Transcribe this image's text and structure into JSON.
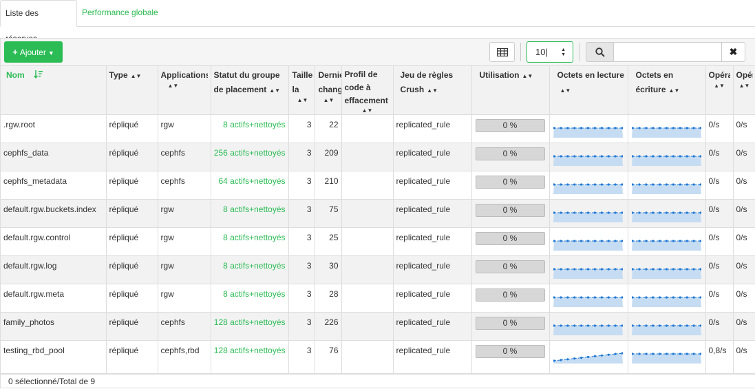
{
  "tabs": [
    {
      "label": "Liste des réserves"
    },
    {
      "label": "Performance globale"
    }
  ],
  "toolbar": {
    "add_label": "Ajouter",
    "page_size": "10",
    "search_placeholder": ""
  },
  "columns": [
    {
      "label": "Nom"
    },
    {
      "label": "Type"
    },
    {
      "label": "Applications"
    },
    {
      "label": "Statut du groupe de placement"
    },
    {
      "label": "Taille de la"
    },
    {
      "label": "Dernier changement"
    },
    {
      "label": "Profil de code à effacement"
    },
    {
      "label": "Jeu de règles Crush"
    },
    {
      "label": "Utilisation"
    },
    {
      "label": "Octets en lecture"
    },
    {
      "label": "Octets en écriture"
    },
    {
      "label": "Opérations de lecture"
    },
    {
      "label": "Opérations d'écriture"
    }
  ],
  "rows": [
    {
      "name": ".rgw.root",
      "type": "répliqué",
      "apps": "rgw",
      "pg_status": "8 actifs+nettoyés",
      "size": "3",
      "last_change": "22",
      "ec_profile": "",
      "crush": "replicated_rule",
      "usage": "0 %",
      "read_ops": "0/s",
      "write_ops": "0/s"
    },
    {
      "name": "cephfs_data",
      "type": "répliqué",
      "apps": "cephfs",
      "pg_status": "256 actifs+nettoyés",
      "size": "3",
      "last_change": "209",
      "ec_profile": "",
      "crush": "replicated_rule",
      "usage": "0 %",
      "read_ops": "0/s",
      "write_ops": "0/s"
    },
    {
      "name": "cephfs_metadata",
      "type": "répliqué",
      "apps": "cephfs",
      "pg_status": "64 actifs+nettoyés",
      "size": "3",
      "last_change": "210",
      "ec_profile": "",
      "crush": "replicated_rule",
      "usage": "0 %",
      "read_ops": "0/s",
      "write_ops": "0/s"
    },
    {
      "name": "default.rgw.buckets.index",
      "type": "répliqué",
      "apps": "rgw",
      "pg_status": "8 actifs+nettoyés",
      "size": "3",
      "last_change": "75",
      "ec_profile": "",
      "crush": "replicated_rule",
      "usage": "0 %",
      "read_ops": "0/s",
      "write_ops": "0/s"
    },
    {
      "name": "default.rgw.control",
      "type": "répliqué",
      "apps": "rgw",
      "pg_status": "8 actifs+nettoyés",
      "size": "3",
      "last_change": "25",
      "ec_profile": "",
      "crush": "replicated_rule",
      "usage": "0 %",
      "read_ops": "0/s",
      "write_ops": "0/s"
    },
    {
      "name": "default.rgw.log",
      "type": "répliqué",
      "apps": "rgw",
      "pg_status": "8 actifs+nettoyés",
      "size": "3",
      "last_change": "30",
      "ec_profile": "",
      "crush": "replicated_rule",
      "usage": "0 %",
      "read_ops": "0/s",
      "write_ops": "0/s"
    },
    {
      "name": "default.rgw.meta",
      "type": "répliqué",
      "apps": "rgw",
      "pg_status": "8 actifs+nettoyés",
      "size": "3",
      "last_change": "28",
      "ec_profile": "",
      "crush": "replicated_rule",
      "usage": "0 %",
      "read_ops": "0/s",
      "write_ops": "0/s"
    },
    {
      "name": "family_photos",
      "type": "répliqué",
      "apps": "cephfs",
      "pg_status": "128 actifs+nettoyés",
      "size": "3",
      "last_change": "226",
      "ec_profile": "",
      "crush": "replicated_rule",
      "usage": "0 %",
      "read_ops": "0/s",
      "write_ops": "0/s"
    },
    {
      "name": "testing_rbd_pool",
      "type": "répliqué",
      "apps": "cephfs,rbd",
      "pg_status": "128 actifs+nettoyés",
      "size": "3",
      "last_change": "76",
      "ec_profile": "",
      "crush": "replicated_rule",
      "usage": "0 %",
      "read_ops": "0,8/s",
      "write_ops": "0/s"
    }
  ],
  "footer": {
    "selection": "0 sélectionné/Total de 9"
  },
  "icons": {
    "add": "plus-icon",
    "dropdown": "caret-down-icon",
    "columns": "table-icon",
    "search": "search-icon",
    "clear": "close-icon",
    "sort": "sort-icon"
  },
  "colors": {
    "accent": "#2bbc55",
    "spark_line": "#1f77d4",
    "spark_fill": "#c6dcf2"
  }
}
